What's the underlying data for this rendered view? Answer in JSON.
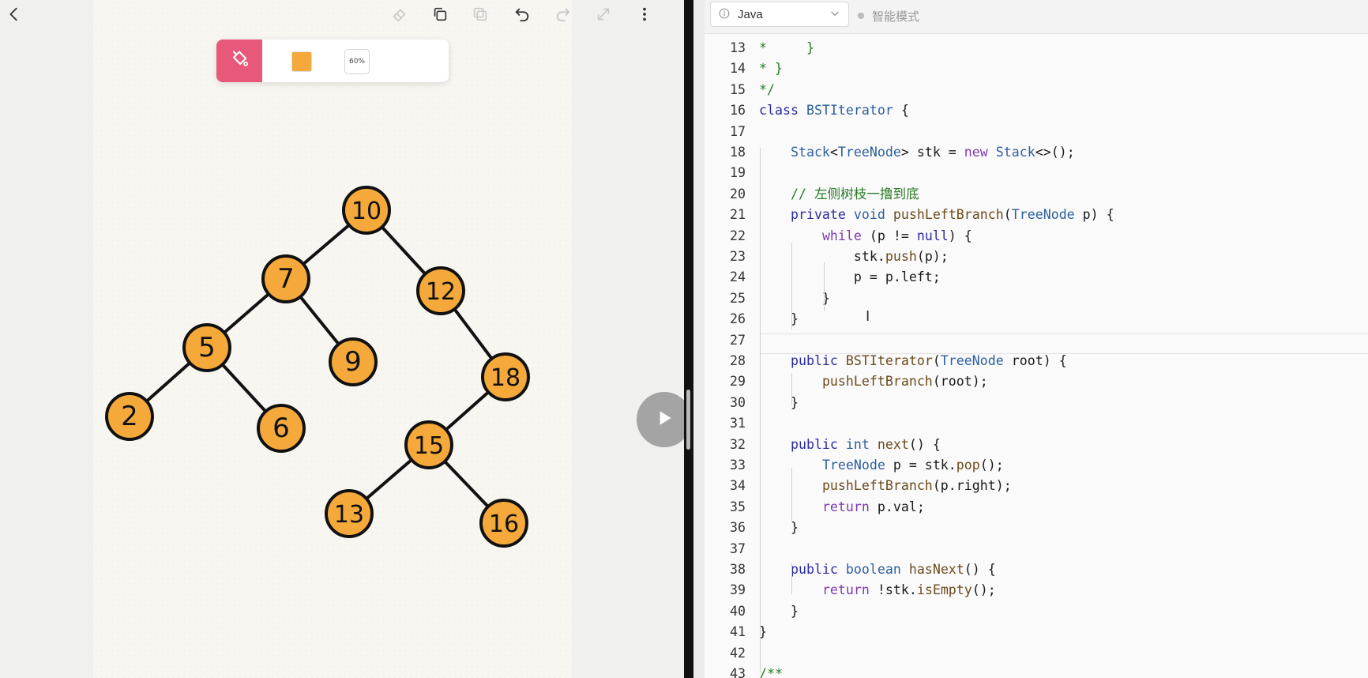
{
  "drawing": {
    "opacity_label": "60%",
    "brush_color": "#f5a93a",
    "accent_color": "#e8587a",
    "toolbar_icons": [
      "back-icon",
      "eraser-icon",
      "copy-icon",
      "paste-icon",
      "undo-icon",
      "redo-icon",
      "resize-icon",
      "more-icon"
    ],
    "tree": {
      "nodes": [
        "10",
        "7",
        "12",
        "5",
        "9",
        "18",
        "2",
        "6",
        "15",
        "13",
        "16"
      ],
      "edges": [
        [
          "10",
          "7"
        ],
        [
          "10",
          "12"
        ],
        [
          "7",
          "5"
        ],
        [
          "7",
          "9"
        ],
        [
          "5",
          "2"
        ],
        [
          "5",
          "6"
        ],
        [
          "12",
          "18"
        ],
        [
          "18",
          "15"
        ],
        [
          "15",
          "13"
        ],
        [
          "15",
          "16"
        ]
      ]
    }
  },
  "editor": {
    "language": "Java",
    "smart_mode_label": "智能模式",
    "lines": [
      {
        "n": "13",
        "t": [
          [
            "cm",
            "*     }"
          ]
        ]
      },
      {
        "n": "14",
        "t": [
          [
            "cm",
            "* }"
          ]
        ]
      },
      {
        "n": "15",
        "t": [
          [
            "cm",
            "*/"
          ]
        ]
      },
      {
        "n": "16",
        "t": [
          [
            "kw",
            "class"
          ],
          [
            "tx",
            " "
          ],
          [
            "ty",
            "BSTIterator"
          ],
          [
            "tx",
            " {"
          ]
        ]
      },
      {
        "n": "17",
        "t": []
      },
      {
        "n": "18",
        "t": [
          [
            "tx",
            "    "
          ],
          [
            "ty",
            "Stack"
          ],
          [
            "tx",
            "<"
          ],
          [
            "ty",
            "TreeNode"
          ],
          [
            "tx",
            "> stk = "
          ],
          [
            "kp",
            "new"
          ],
          [
            "tx",
            " "
          ],
          [
            "ty",
            "Stack"
          ],
          [
            "tx",
            "<>();"
          ]
        ]
      },
      {
        "n": "19",
        "t": []
      },
      {
        "n": "20",
        "t": [
          [
            "tx",
            "    "
          ],
          [
            "cm",
            "// 左侧树枝一撸到底"
          ]
        ]
      },
      {
        "n": "21",
        "t": [
          [
            "tx",
            "    "
          ],
          [
            "kw",
            "private"
          ],
          [
            "tx",
            " "
          ],
          [
            "ty",
            "void"
          ],
          [
            "tx",
            " "
          ],
          [
            "fn",
            "pushLeftBranch"
          ],
          [
            "tx",
            "("
          ],
          [
            "ty",
            "TreeNode"
          ],
          [
            "tx",
            " p) {"
          ]
        ]
      },
      {
        "n": "22",
        "t": [
          [
            "tx",
            "        "
          ],
          [
            "kp",
            "while"
          ],
          [
            "tx",
            " (p != "
          ],
          [
            "kw",
            "null"
          ],
          [
            "tx",
            ") {"
          ]
        ]
      },
      {
        "n": "23",
        "t": [
          [
            "tx",
            "            stk."
          ],
          [
            "fn",
            "push"
          ],
          [
            "tx",
            "(p);"
          ]
        ]
      },
      {
        "n": "24",
        "t": [
          [
            "tx",
            "            p = p.left;"
          ]
        ]
      },
      {
        "n": "25",
        "t": [
          [
            "tx",
            "        }"
          ]
        ]
      },
      {
        "n": "26",
        "t": [
          [
            "tx",
            "    }"
          ]
        ]
      },
      {
        "n": "27",
        "t": []
      },
      {
        "n": "28",
        "t": [
          [
            "tx",
            "    "
          ],
          [
            "kw",
            "public"
          ],
          [
            "tx",
            " "
          ],
          [
            "fn",
            "BSTIterator"
          ],
          [
            "tx",
            "("
          ],
          [
            "ty",
            "TreeNode"
          ],
          [
            "tx",
            " root) {"
          ]
        ]
      },
      {
        "n": "29",
        "t": [
          [
            "tx",
            "        "
          ],
          [
            "fn",
            "pushLeftBranch"
          ],
          [
            "tx",
            "(root);"
          ]
        ]
      },
      {
        "n": "30",
        "t": [
          [
            "tx",
            "    }"
          ]
        ]
      },
      {
        "n": "31",
        "t": []
      },
      {
        "n": "32",
        "t": [
          [
            "tx",
            "    "
          ],
          [
            "kw",
            "public"
          ],
          [
            "tx",
            " "
          ],
          [
            "ty",
            "int"
          ],
          [
            "tx",
            " "
          ],
          [
            "fn",
            "next"
          ],
          [
            "tx",
            "() {"
          ]
        ]
      },
      {
        "n": "33",
        "t": [
          [
            "tx",
            "        "
          ],
          [
            "ty",
            "TreeNode"
          ],
          [
            "tx",
            " p = stk."
          ],
          [
            "fn",
            "pop"
          ],
          [
            "tx",
            "();"
          ]
        ]
      },
      {
        "n": "34",
        "t": [
          [
            "tx",
            "        "
          ],
          [
            "fn",
            "pushLeftBranch"
          ],
          [
            "tx",
            "(p.right);"
          ]
        ]
      },
      {
        "n": "35",
        "t": [
          [
            "tx",
            "        "
          ],
          [
            "kp",
            "return"
          ],
          [
            "tx",
            " p.val;"
          ]
        ]
      },
      {
        "n": "36",
        "t": [
          [
            "tx",
            "    }"
          ]
        ]
      },
      {
        "n": "37",
        "t": []
      },
      {
        "n": "38",
        "t": [
          [
            "tx",
            "    "
          ],
          [
            "kw",
            "public"
          ],
          [
            "tx",
            " "
          ],
          [
            "ty",
            "boolean"
          ],
          [
            "tx",
            " "
          ],
          [
            "fn",
            "hasNext"
          ],
          [
            "tx",
            "() {"
          ]
        ]
      },
      {
        "n": "39",
        "t": [
          [
            "tx",
            "        "
          ],
          [
            "kp",
            "return"
          ],
          [
            "tx",
            " !stk."
          ],
          [
            "fn",
            "isEmpty"
          ],
          [
            "tx",
            "();"
          ]
        ]
      },
      {
        "n": "40",
        "t": [
          [
            "tx",
            "    }"
          ]
        ]
      },
      {
        "n": "41",
        "t": [
          [
            "tx",
            "}"
          ]
        ]
      },
      {
        "n": "42",
        "t": []
      },
      {
        "n": "43",
        "t": [
          [
            "cm",
            "/**"
          ]
        ]
      }
    ]
  }
}
